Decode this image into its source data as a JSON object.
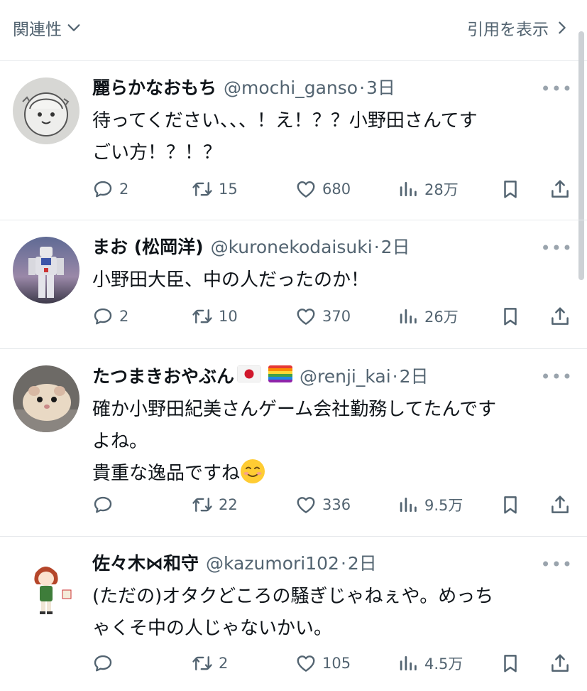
{
  "header": {
    "sort_label": "関連性",
    "quotes_label": "引用を表示"
  },
  "replies": [
    {
      "name": "麗らかなおもち",
      "handle": "@mochi_ganso",
      "separator": "·",
      "time": "3日",
      "text": "待ってください、、、！え！？？小野田さんてす\nごい方！？！？",
      "replies_count": "2",
      "reposts_count": "15",
      "likes_count": "680",
      "views_count": "28万"
    },
    {
      "name": "まお (松岡洋)",
      "handle": "@kuronekodaisuki",
      "separator": "·",
      "time": "2日",
      "text": "小野田大臣、中の人だったのか！",
      "replies_count": "2",
      "reposts_count": "10",
      "likes_count": "370",
      "views_count": "26万"
    },
    {
      "name": "たつまきおやぶん",
      "name_emoji": [
        "japan-flag-emoji",
        "rainbow-flag-emoji"
      ],
      "handle": "@renji_kai",
      "separator": "·",
      "time": "2日",
      "text": "確か小野田紀美さんゲーム会社勤務してたんです\nよね。\n貴重な逸品ですね",
      "text_emoji": "smiling-face-emoji",
      "replies_count": "",
      "reposts_count": "22",
      "likes_count": "336",
      "views_count": "9.5万"
    },
    {
      "name": "佐々木⋈和守",
      "handle": "@kazumori102",
      "separator": "·",
      "time": "2日",
      "text": "(ただの)オタクどころの騒ぎじゃねぇや。めっち\nゃくそ中の人じゃないかい。",
      "replies_count": "",
      "reposts_count": "2",
      "likes_count": "105",
      "views_count": "4.5万"
    }
  ],
  "icons": [
    "chevron-down-icon",
    "chevron-right-icon",
    "more-icon",
    "reply-icon",
    "repost-icon",
    "like-icon",
    "views-icon",
    "bookmark-icon",
    "share-icon"
  ],
  "colors": {
    "text": "#0f1419",
    "secondary": "#536471",
    "divider": "#e6e9ec"
  }
}
